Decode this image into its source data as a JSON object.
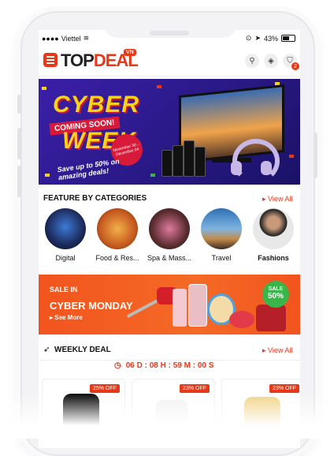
{
  "status_bar": {
    "carrier": "Viettel",
    "signal": "●●●●",
    "battery_pct": "43%"
  },
  "header": {
    "logo_part1": "TOP",
    "logo_part2": "DEAL",
    "logo_badge": "VN"
  },
  "cart": {
    "count": "2"
  },
  "banner": {
    "line1": "CYBER",
    "line2": "COMING SOON!",
    "line3": "WEEK",
    "promo": "Save up to 50% on amazing deals!",
    "dates": "November 30 – December 04",
    "slides": 6,
    "active_slide": 1
  },
  "categories_section": {
    "title": "FEATURE BY CATEGORIES",
    "view_all": "View All",
    "items": [
      {
        "label": "Digital",
        "color": "#1c2a5a"
      },
      {
        "label": "Food & Res...",
        "color": "#c65a1f"
      },
      {
        "label": "Spa & Mass...",
        "color": "#5b2d2f"
      },
      {
        "label": "Travel",
        "color": "#2d6fb3"
      },
      {
        "label": "Fashions",
        "color": "#e8e8e8"
      }
    ]
  },
  "promo": {
    "line1": "SALE IN",
    "line2": "CYBER MONDAY",
    "line3": "See More",
    "badge_title": "SALE",
    "badge_value": "50%"
  },
  "weekly": {
    "title": "WEEKLY DEAL",
    "view_all": "View All",
    "countdown": "06 D : 08 H : 59 M : 00 S"
  },
  "deals": [
    {
      "discount": "25% OFF"
    },
    {
      "discount": "23% OFF"
    },
    {
      "discount": "23% OFF"
    }
  ],
  "colors": {
    "accent": "#e53919",
    "banner_bg": "#2c1a8c",
    "promo_bg": "#f2541e",
    "sale_green": "#3ab54a"
  }
}
